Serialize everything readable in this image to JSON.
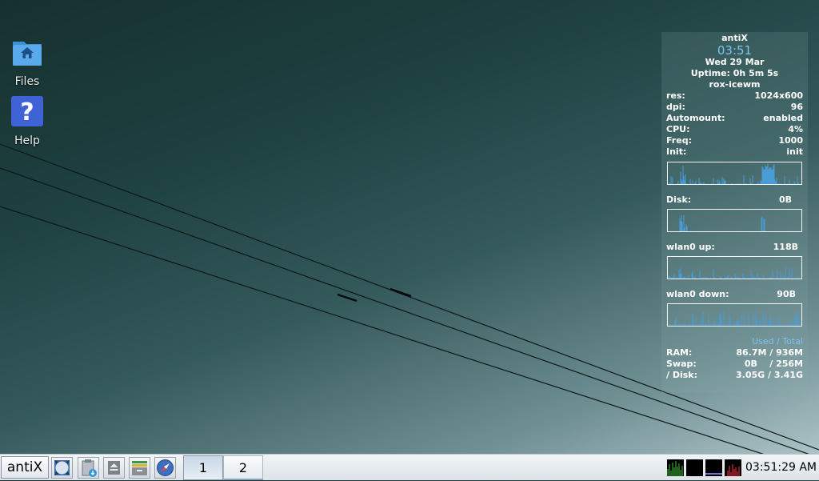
{
  "desktop": {
    "icons": [
      {
        "label": "Files",
        "icon": "folder-home-icon"
      },
      {
        "label": "Help",
        "icon": "help-question-icon"
      }
    ]
  },
  "conky": {
    "distro": "antiX",
    "time": "03:51",
    "date": "Wed 29 Mar",
    "uptime": "Uptime: 0h 5m 5s",
    "wm": "rox-icewm",
    "stats": [
      {
        "label": "res:",
        "value": "1024x600"
      },
      {
        "label": "dpi:",
        "value": "96"
      },
      {
        "label": "Automount:",
        "value": "enabled"
      },
      {
        "label": "CPU:",
        "value": "4%"
      },
      {
        "label": "Freq:",
        "value": "1000"
      },
      {
        "label": "Init:",
        "value": "init"
      }
    ],
    "disk": {
      "label": "Disk:",
      "value": "0B"
    },
    "wlan_up": {
      "label": "wlan0 up:",
      "value": "118B"
    },
    "wlan_down": {
      "label": "wlan0 down:",
      "value": "90B"
    },
    "usage_header": "Used / Total",
    "usage": [
      {
        "label": "RAM:",
        "value": "86.7M / 936M"
      },
      {
        "label": "Swap:",
        "value": "0B    / 256M"
      },
      {
        "label": "/ Disk:",
        "value": "3.05G / 3.41G"
      }
    ],
    "graph_color": "#4a9bd6"
  },
  "taskbar": {
    "start_label": "antiX",
    "launchers": [
      "show-desktop-icon",
      "clipboard-icon",
      "eject-icon",
      "file-manager-icon",
      "browser-icon"
    ],
    "workspaces": [
      "1",
      "2"
    ],
    "active_workspace": "1",
    "monitors": [
      "cpu-monitor-icon",
      "memory-monitor-icon",
      "network-monitor-icon",
      "battery-monitor-icon"
    ],
    "clock": "03:51:29 AM"
  }
}
